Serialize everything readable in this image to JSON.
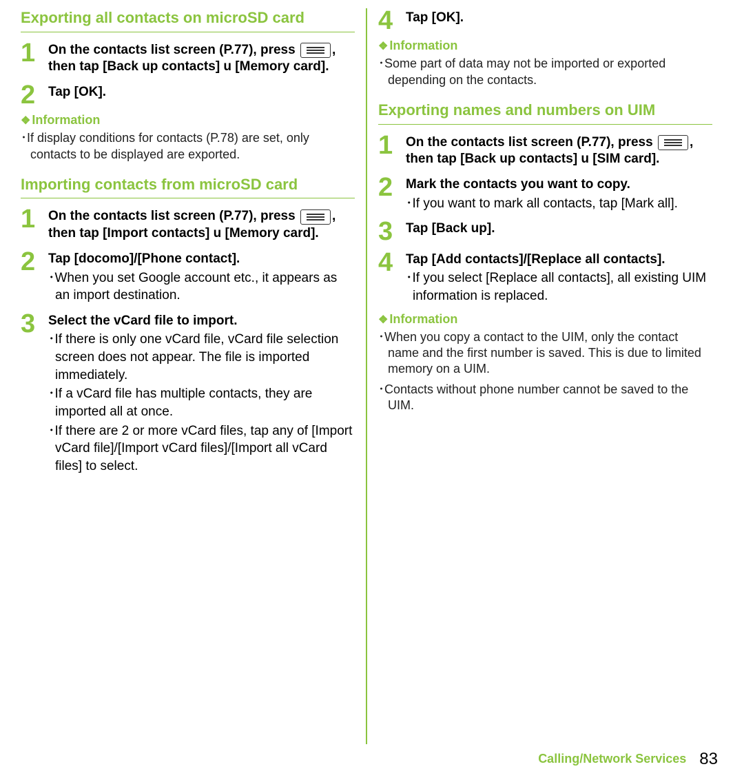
{
  "footer": {
    "section": "Calling/Network Services",
    "page": "83"
  },
  "left": {
    "sec1": {
      "title": "Exporting all contacts on microSD card",
      "steps": [
        {
          "n": "1",
          "title_a": "On the contacts list screen (P.77), press ",
          "title_b": ", then tap [Back up contacts] ",
          "arrow": "u",
          "title_c": " [Memory card]."
        },
        {
          "n": "2",
          "title": "Tap [OK]."
        }
      ],
      "info_h": "Information",
      "info": [
        "･If display conditions for contacts (P.78) are set, only contacts to be displayed are exported."
      ]
    },
    "sec2": {
      "title": "Importing contacts from microSD card",
      "steps": [
        {
          "n": "1",
          "title_a": "On the contacts list screen (P.77), press ",
          "title_b": ", then tap [Import contacts] ",
          "arrow": "u",
          "title_c": " [Memory card]."
        },
        {
          "n": "2",
          "title": "Tap [docomo]/[Phone contact].",
          "subs": [
            "･When you set Google account etc., it appears as an import destination."
          ]
        },
        {
          "n": "3",
          "title": "Select the vCard file to import.",
          "subs": [
            "･If there is only one vCard file, vCard file selection screen does not appear. The file is imported immediately.",
            "･If a vCard file has multiple contacts, they are imported all at once.",
            "･If there are 2 or more vCard files, tap any of [Import vCard file]/[Import vCard files]/[Import all vCard files] to select."
          ]
        }
      ]
    }
  },
  "right": {
    "sec1": {
      "steps": [
        {
          "n": "4",
          "title": "Tap [OK]."
        }
      ],
      "info_h": "Information",
      "info": [
        "･Some part of data may not be imported or exported depending on the contacts."
      ]
    },
    "sec2": {
      "title": "Exporting names and numbers on UIM",
      "steps": [
        {
          "n": "1",
          "title_a": "On the contacts list screen (P.77), press ",
          "title_b": ", then tap [Back up contacts] ",
          "arrow": "u",
          "title_c": " [SIM card]."
        },
        {
          "n": "2",
          "title": "Mark the contacts you want to copy.",
          "subs": [
            "･If you want to mark all contacts, tap [Mark all]."
          ]
        },
        {
          "n": "3",
          "title": "Tap [Back up]."
        },
        {
          "n": "4",
          "title": "Tap [Add contacts]/[Replace all contacts].",
          "subs": [
            "･If you select [Replace all contacts], all existing UIM information is replaced."
          ]
        }
      ],
      "info_h": "Information",
      "info": [
        "･When you copy a contact to the UIM, only the contact name and the first number is saved. This is due to limited memory on a UIM.",
        "･Contacts without phone number cannot be saved to the UIM."
      ]
    }
  }
}
